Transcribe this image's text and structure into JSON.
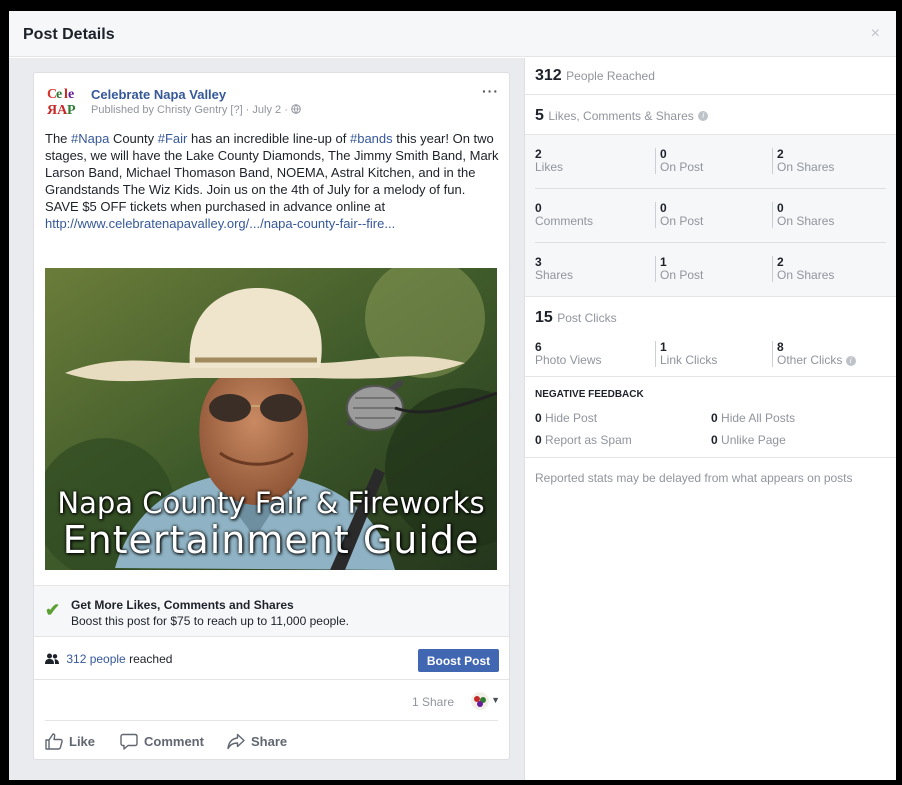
{
  "dialog": {
    "title": "Post Details",
    "close_icon": "×"
  },
  "post": {
    "page_name": "Celebrate Napa Valley",
    "meta": "Published by Christy Gentry [?] · July 2 · ",
    "more": "···",
    "text_parts": {
      "p1": "The ",
      "h1": "#Napa",
      "p2": " County ",
      "h2": "#Fair",
      "p3": " has an incredible line-up of ",
      "h3": "#bands",
      "p4": " this year! On two stages, we will have the Lake County Diamonds, The Jimmy Smith Band, Mark Larson Band, Michael Thomason Band, NOEMA, Astral Kitchen, and in the Grandstands The Wiz Kids. Join us on the 4th of July for a melody of fun. SAVE $5 OFF tickets when purchased in advance online at ",
      "url": "http://www.celebratenapavalley.org/.../napa-county-fair--fire..."
    },
    "image_text": {
      "line1": "Napa County Fair & Fireworks",
      "line2": "Entertainment Guide"
    },
    "boost_tip": {
      "title": "Get More Likes, Comments and Shares",
      "body": "Boost this post for $75 to reach up to 11,000 people."
    },
    "reach": {
      "count": "312 people",
      "suffix": " reached"
    },
    "boost_button": "Boost Post",
    "shares": "1 Share",
    "actions": {
      "like": "Like",
      "comment": "Comment",
      "share": "Share"
    }
  },
  "stats": {
    "people_reached": {
      "value": "312",
      "label": "People Reached"
    },
    "engagement": {
      "value": "5",
      "label": "Likes, Comments & Shares"
    },
    "rows": [
      {
        "total": "2",
        "total_label": "Likes",
        "on_post": "0",
        "on_post_label": "On Post",
        "on_shares": "2",
        "on_shares_label": "On Shares"
      },
      {
        "total": "0",
        "total_label": "Comments",
        "on_post": "0",
        "on_post_label": "On Post",
        "on_shares": "0",
        "on_shares_label": "On Shares"
      },
      {
        "total": "3",
        "total_label": "Shares",
        "on_post": "1",
        "on_post_label": "On Post",
        "on_shares": "2",
        "on_shares_label": "On Shares"
      }
    ],
    "post_clicks": {
      "value": "15",
      "label": "Post Clicks"
    },
    "clicks": [
      {
        "value": "6",
        "label": "Photo Views"
      },
      {
        "value": "1",
        "label": "Link Clicks"
      },
      {
        "value": "8",
        "label": "Other Clicks"
      }
    ],
    "negative": {
      "title": "NEGATIVE FEEDBACK",
      "hide_post": {
        "value": "0",
        "label": "Hide Post"
      },
      "hide_all": {
        "value": "0",
        "label": "Hide All Posts"
      },
      "spam": {
        "value": "0",
        "label": "Report as Spam"
      },
      "unlike": {
        "value": "0",
        "label": "Unlike Page"
      }
    },
    "note": "Reported stats may be delayed from what appears on posts"
  },
  "colors": {
    "link": "#365899",
    "boost": "#4267b2",
    "check": "#5ba032"
  }
}
